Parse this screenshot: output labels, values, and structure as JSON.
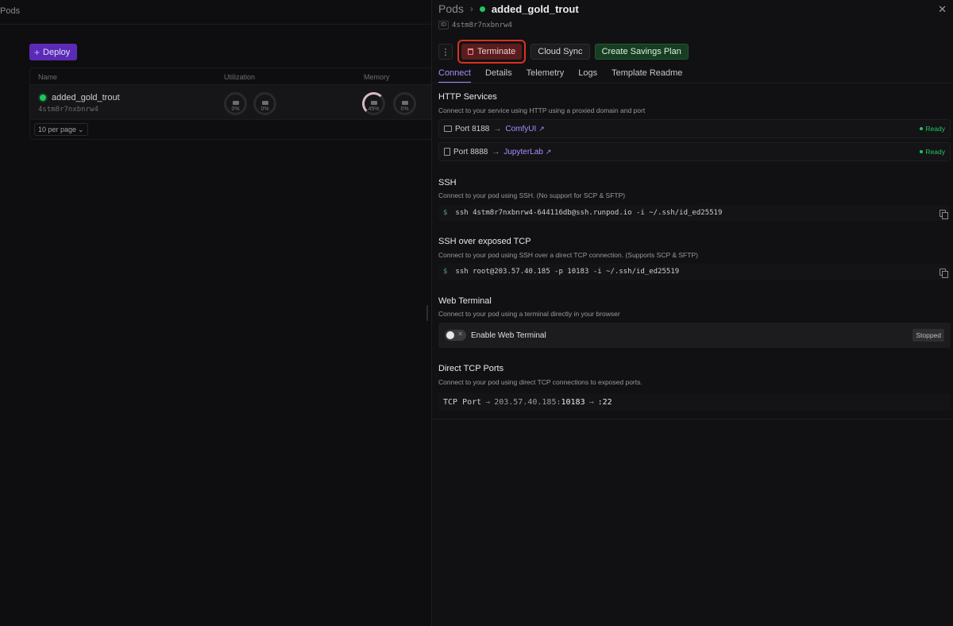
{
  "left": {
    "header_title": "Pods",
    "deploy_label": "Deploy",
    "columns": [
      "Name",
      "Utilization",
      "Memory"
    ],
    "row": {
      "name": "added_gold_trout",
      "id": "4stm8r7nxbnrw4",
      "util": [
        "0%",
        "0%"
      ],
      "memory": [
        "45%",
        "0%"
      ]
    },
    "per_page": "10 per page"
  },
  "drawer": {
    "crumb_root": "Pods",
    "title": "added_gold_trout",
    "id_badge": "ID",
    "id_value": "4stm8r7nxbnrw4",
    "actions": {
      "kebab": "⋮",
      "terminate": "Terminate",
      "cloud_sync": "Cloud Sync",
      "savings": "Create Savings Plan"
    },
    "tabs": [
      "Connect",
      "Details",
      "Telemetry",
      "Logs",
      "Template Readme"
    ],
    "http": {
      "title": "HTTP Services",
      "desc": "Connect to your service using HTTP using a proxied domain and port",
      "services": [
        {
          "port": "Port 8188",
          "name": "ComfyUI",
          "status": "Ready"
        },
        {
          "port": "Port 8888",
          "name": "JupyterLab",
          "status": "Ready"
        }
      ]
    },
    "ssh": {
      "title": "SSH",
      "desc": "Connect to your pod using SSH. (No support for SCP & SFTP)",
      "prompt": "$",
      "cmd": "ssh 4stm8r7nxbnrw4-644116db@ssh.runpod.io -i ~/.ssh/id_ed25519"
    },
    "ssh_tcp": {
      "title": "SSH over exposed TCP",
      "desc": "Connect to your pod using SSH over a direct TCP connection. (Supports SCP & SFTP)",
      "prompt": "$",
      "cmd": "ssh root@203.57.40.185 -p 10183 -i ~/.ssh/id_ed25519"
    },
    "web_terminal": {
      "title": "Web Terminal",
      "desc": "Connect to your pod using a terminal directly in your browser",
      "toggle_x": "✕",
      "label": "Enable Web Terminal",
      "status": "Stopped"
    },
    "tcp_ports": {
      "title": "Direct TCP Ports",
      "desc": "Connect to your pod using direct TCP connections to exposed ports.",
      "label": "TCP Port",
      "ip": "203.57.40.185:",
      "ext_port": "10183",
      "int_port": ":22"
    }
  }
}
